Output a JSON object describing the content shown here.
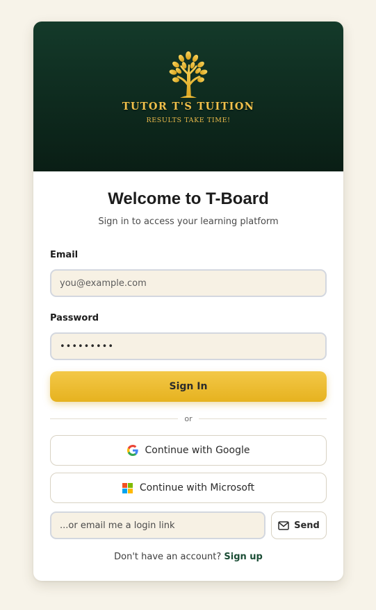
{
  "brand": {
    "name": "TUTOR T'S TUITION",
    "tagline": "RESULTS TAKE TIME!",
    "gold": "#f2c14b",
    "green_dark": "#0e2a1e"
  },
  "header": {
    "title": "Welcome to T-Board",
    "subtitle": "Sign in to access your learning platform"
  },
  "form": {
    "email_label": "Email",
    "email_placeholder": "you@example.com",
    "email_value": "",
    "password_label": "Password",
    "password_value": "•••••••••",
    "signin_label": "Sign In"
  },
  "divider_text": "or",
  "oauth": {
    "google_label": "Continue with Google",
    "google_icon": "google-icon",
    "microsoft_label": "Continue with Microsoft",
    "microsoft_icon": "microsoft-icon"
  },
  "magic_link": {
    "placeholder": "...or email me a login link",
    "send_label": "Send",
    "send_icon": "mail-icon"
  },
  "footer": {
    "prompt": "Don't have an account?",
    "signup_label": "Sign up"
  },
  "colors": {
    "accent": "#e6b21f",
    "background": "#f7f3e9",
    "input_bg": "#f7f1e4",
    "link": "#1b4d35"
  }
}
